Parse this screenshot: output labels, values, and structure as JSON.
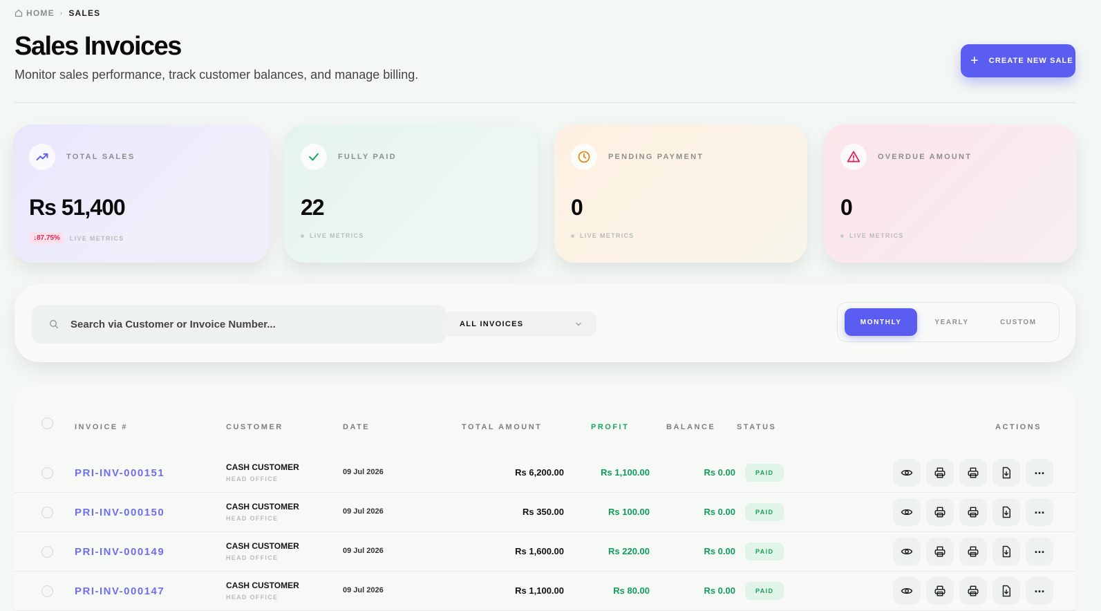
{
  "breadcrumb": {
    "home": "HOME",
    "current": "SALES"
  },
  "header": {
    "title": "Sales Invoices",
    "subtitle": "Monitor sales performance, track customer balances, and manage billing.",
    "create_label": "CREATE NEW SALE"
  },
  "stats": [
    {
      "label": "TOTAL SALES",
      "value": "Rs 51,400",
      "badge": "↓87.75%",
      "foot": "LIVE METRICS",
      "icon": "trend-up-icon",
      "color": "#5b5cf0"
    },
    {
      "label": "FULLY PAID",
      "value": "22",
      "foot": "LIVE METRICS",
      "icon": "check-icon",
      "color": "#0f9d58"
    },
    {
      "label": "PENDING PAYMENT",
      "value": "0",
      "foot": "LIVE METRICS",
      "icon": "clock-icon",
      "color": "#e88a1a"
    },
    {
      "label": "OVERDUE AMOUNT",
      "value": "0",
      "foot": "LIVE METRICS",
      "icon": "alert-icon",
      "color": "#e0245e"
    }
  ],
  "filters": {
    "search_placeholder": "Search via Customer or Invoice Number...",
    "invoice_filter": "ALL INVOICES",
    "periods": [
      "MONTHLY",
      "YEARLY",
      "CUSTOM"
    ],
    "active_period": "MONTHLY"
  },
  "table": {
    "columns": [
      "INVOICE #",
      "CUSTOMER",
      "DATE",
      "TOTAL AMOUNT",
      "PROFIT",
      "BALANCE",
      "STATUS",
      "ACTIONS"
    ],
    "rows": [
      {
        "invoice": "PRI-INV-000151",
        "customer": "CASH CUSTOMER",
        "branch": "HEAD OFFICE",
        "date": "09 Jul 2026",
        "total": "Rs 6,200.00",
        "profit": "Rs 1,100.00",
        "balance": "Rs 0.00",
        "status": "PAID"
      },
      {
        "invoice": "PRI-INV-000150",
        "customer": "CASH CUSTOMER",
        "branch": "HEAD OFFICE",
        "date": "09 Jul 2026",
        "total": "Rs 350.00",
        "profit": "Rs 100.00",
        "balance": "Rs 0.00",
        "status": "PAID"
      },
      {
        "invoice": "PRI-INV-000149",
        "customer": "CASH CUSTOMER",
        "branch": "HEAD OFFICE",
        "date": "09 Jul 2026",
        "total": "Rs 1,600.00",
        "profit": "Rs 220.00",
        "balance": "Rs 0.00",
        "status": "PAID"
      },
      {
        "invoice": "PRI-INV-000147",
        "customer": "CASH CUSTOMER",
        "branch": "HEAD OFFICE",
        "date": "09 Jul 2026",
        "total": "Rs 1,100.00",
        "profit": "Rs 80.00",
        "balance": "Rs 0.00",
        "status": "PAID"
      }
    ],
    "row_actions": [
      "view-icon",
      "print-icon",
      "print-thermal-icon",
      "download-pdf-icon",
      "more-icon"
    ]
  }
}
